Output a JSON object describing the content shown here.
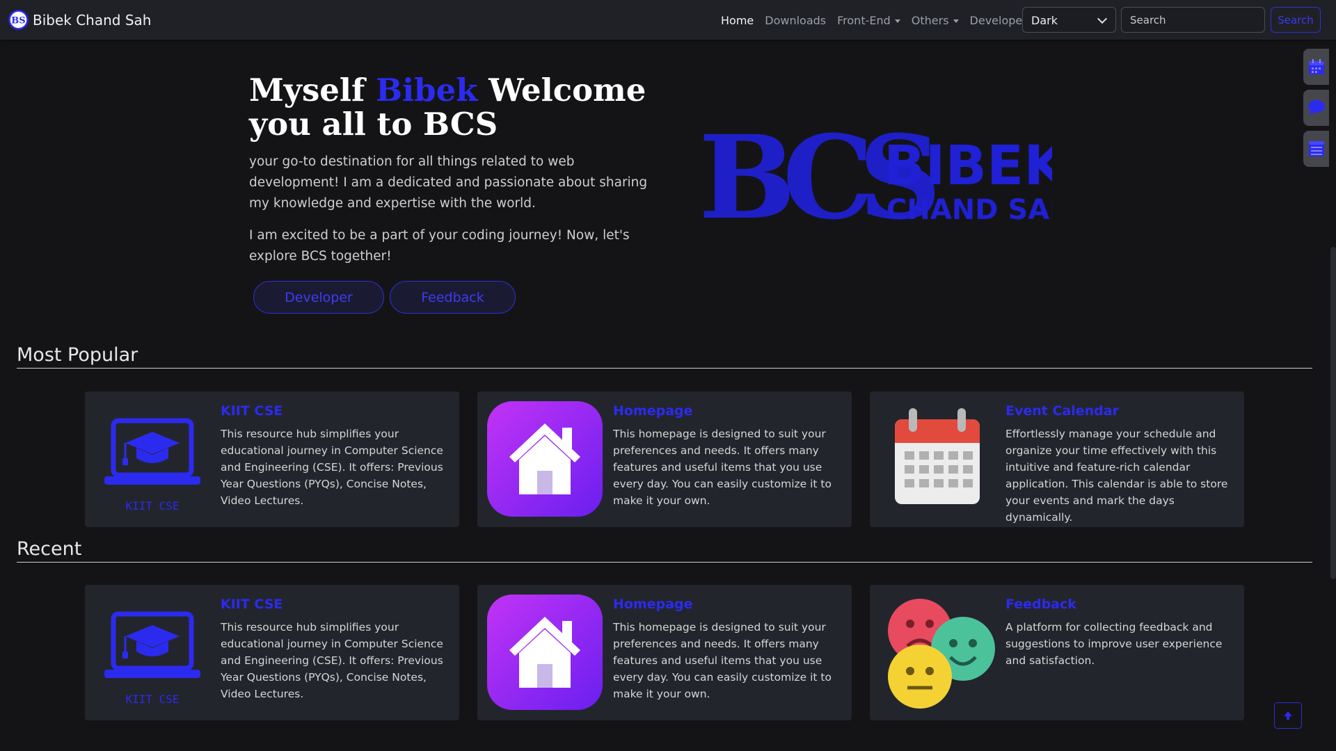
{
  "brand": {
    "name": "Bibek Chand Sah",
    "logo_text": "BS"
  },
  "nav": {
    "items": [
      {
        "label": "Home",
        "active": true
      },
      {
        "label": "Downloads"
      },
      {
        "label": "Front-End",
        "dropdown": true
      },
      {
        "label": "Others",
        "dropdown": true
      },
      {
        "label": "Developer"
      }
    ],
    "theme_value": "Dark",
    "search_placeholder": "Search",
    "search_button": "Search"
  },
  "side_widgets": [
    "calendar-icon",
    "chat-icon",
    "list-icon"
  ],
  "hero": {
    "title_part1": "Myself ",
    "title_accent": "Bibek",
    "title_part2": " Welcome you all to BCS",
    "para1": "your go-to destination for all things related to web development! I am a dedicated and passionate about sharing my knowledge and expertise with the world.",
    "para2": "I am excited to be a part of your coding journey! Now, let's explore BCS together!",
    "btn_developer": "Developer",
    "btn_feedback": "Feedback",
    "logo": {
      "mark": "BCS",
      "line1": "BIBEK",
      "line2": "CHAND SAH"
    }
  },
  "sections": {
    "popular_title": "Most Popular",
    "recent_title": "Recent"
  },
  "popular": [
    {
      "title": "KIIT CSE",
      "text": "This resource hub simplifies your educational journey in Computer Science and Engineering (CSE). It offers: Previous Year Questions (PYQs), Concise Notes, Video Lectures.",
      "image_label": "KIIT CSE"
    },
    {
      "title": "Homepage",
      "text": "This homepage is designed to suit your preferences and needs. It offers many features and useful items that you use every day. You can easily customize it to make it your own."
    },
    {
      "title": "Event Calendar",
      "text": "Effortlessly manage your schedule and organize your time effectively with this intuitive and feature-rich calendar application. This calendar is able to store your events and mark the days dynamically."
    }
  ],
  "recent": [
    {
      "title": "KIIT CSE",
      "text": "This resource hub simplifies your educational journey in Computer Science and Engineering (CSE). It offers: Previous Year Questions (PYQs), Concise Notes, Video Lectures.",
      "image_label": "KIIT CSE"
    },
    {
      "title": "Homepage",
      "text": "This homepage is designed to suit your preferences and needs. It offers many features and useful items that you use every day. You can easily customize it to make it your own."
    },
    {
      "title": "Feedback",
      "text": "A platform for collecting feedback and suggestions to improve user experience and satisfaction."
    }
  ],
  "colors": {
    "accent": "#2b2bf0",
    "background": "#141416",
    "card": "#23252c",
    "navbar": "#1f2126"
  }
}
